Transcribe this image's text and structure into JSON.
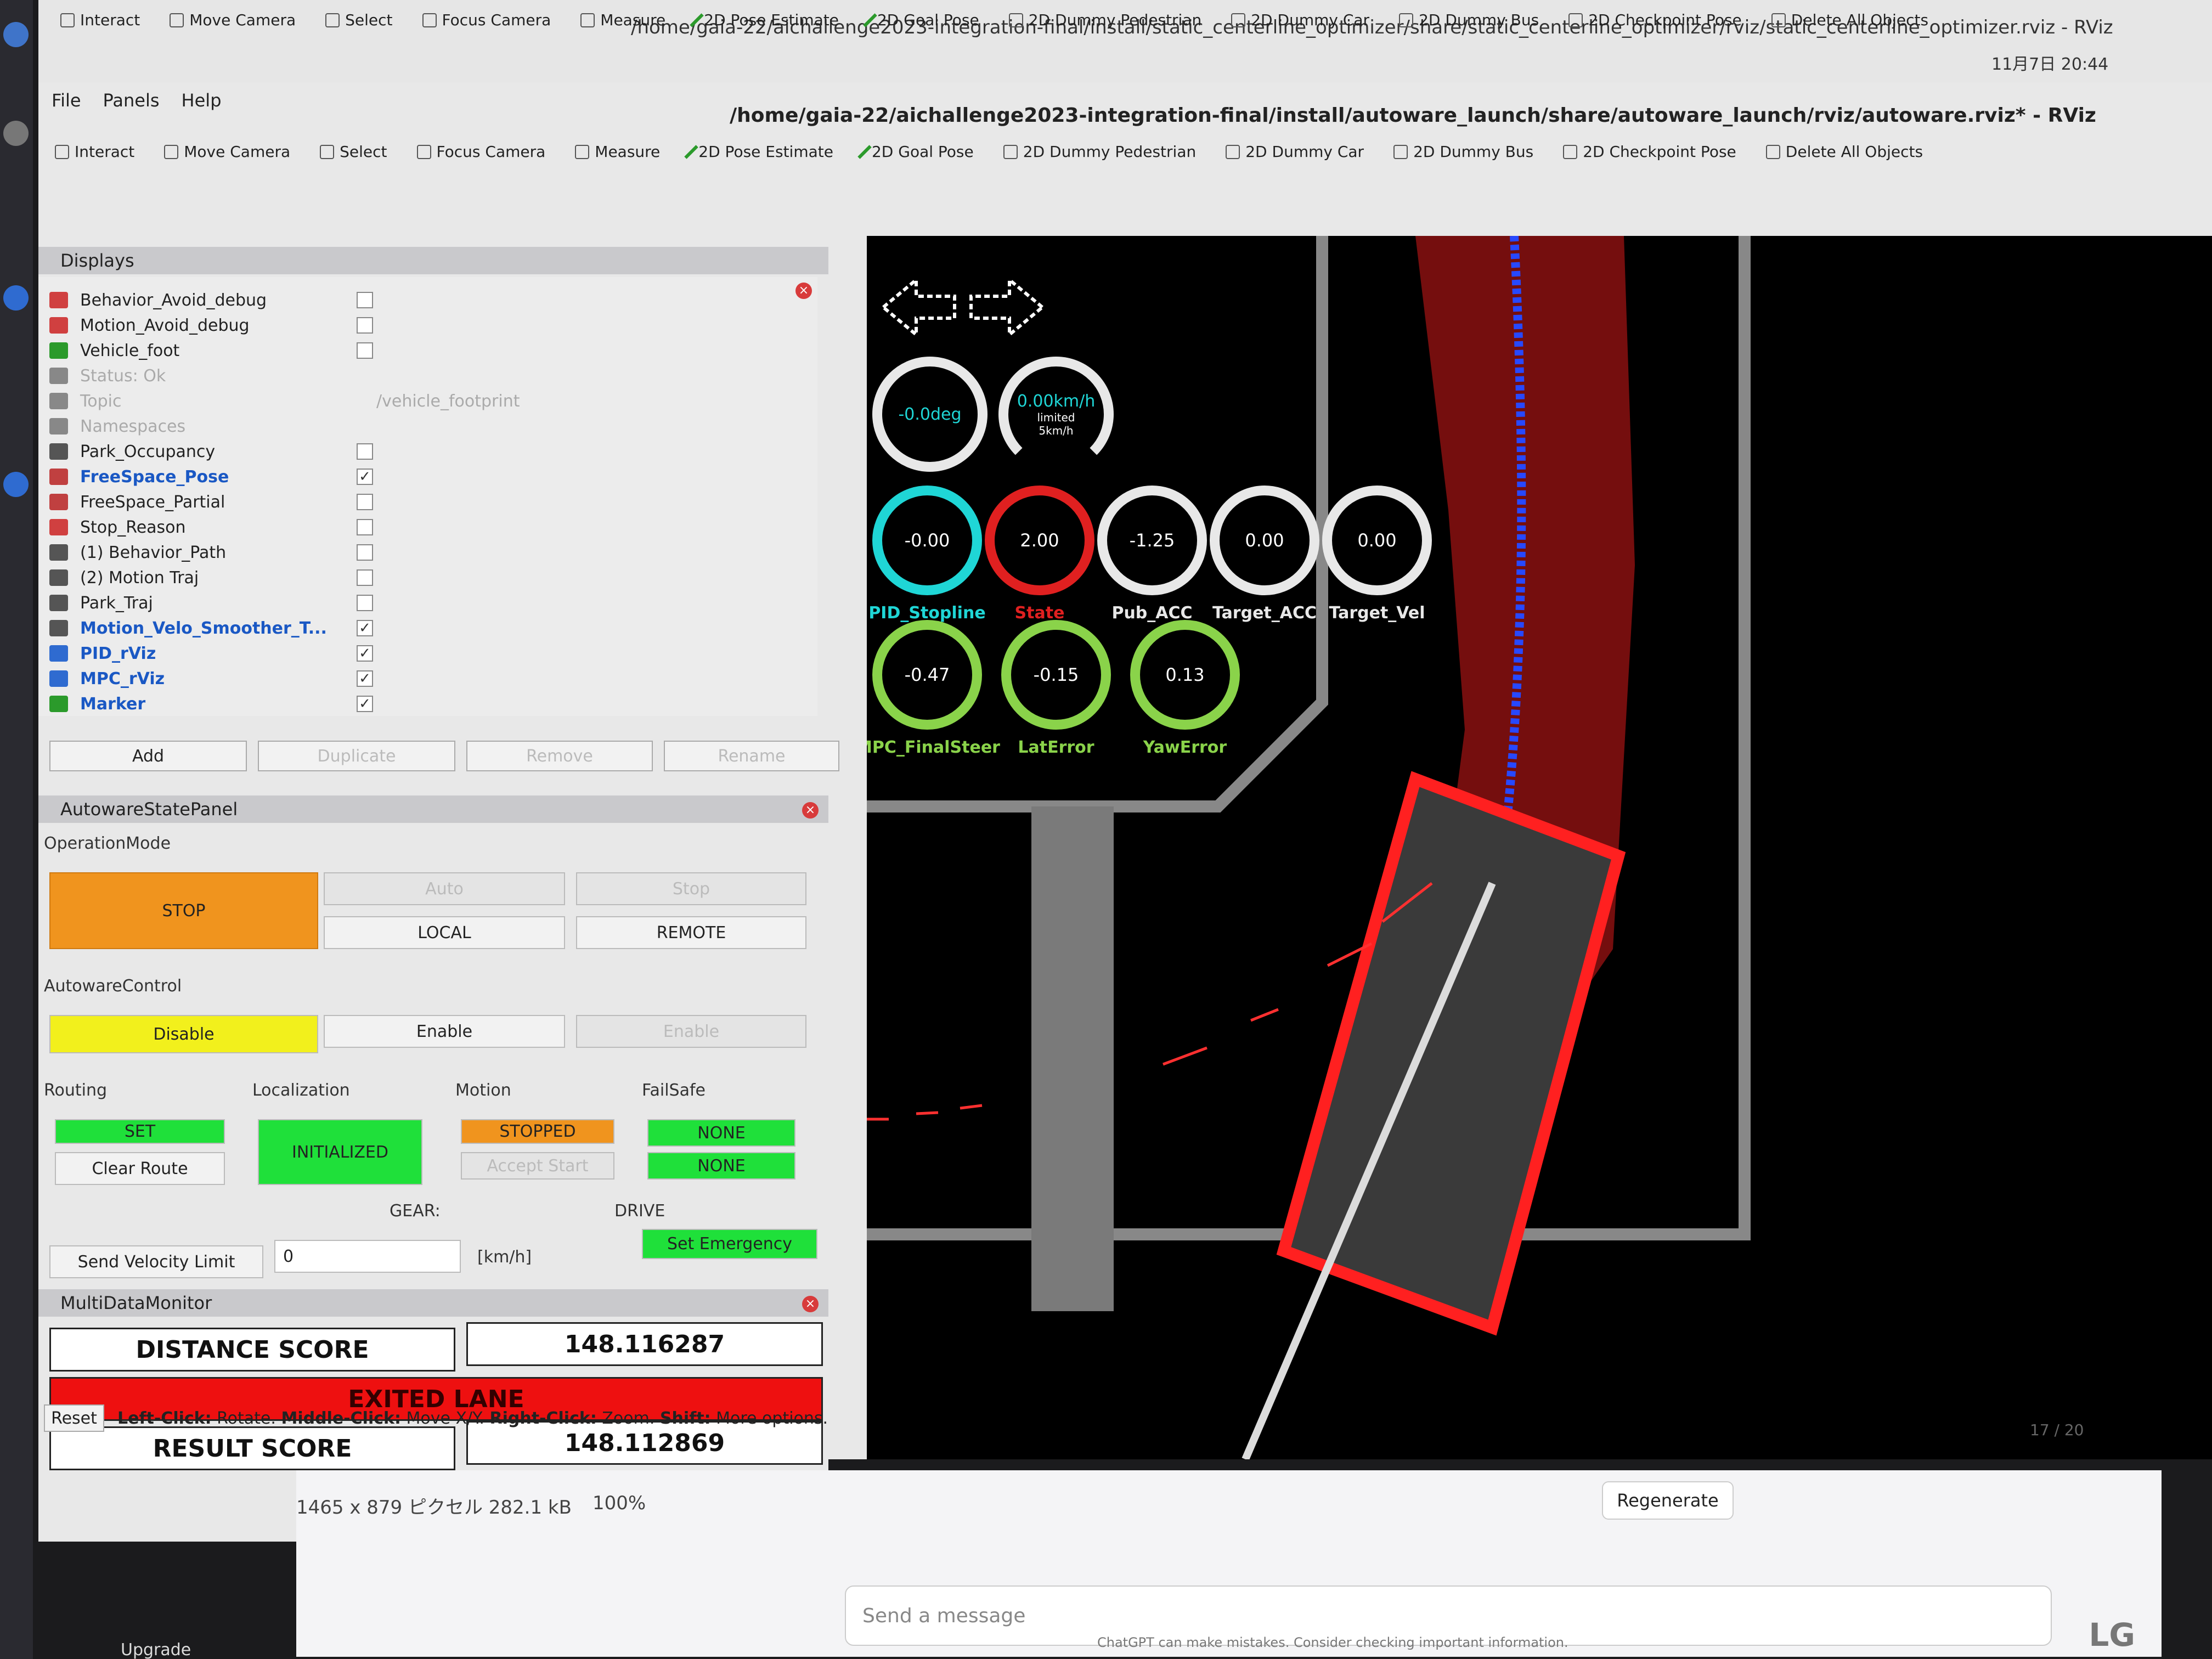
{
  "bg_window": {
    "title": "/home/gaia-22/aichallenge2023-integration-final/install/static_centerline_optimizer/share/static_centerline_optimizer/rviz/static_centerline_optimizer.rviz - RViz",
    "clock": "11月7日 20:44",
    "toolbar": [
      "Interact",
      "Move Camera",
      "Select",
      "Focus Camera",
      "Measure",
      "2D Pose Estimate",
      "2D Goal Pose",
      "2D Dummy Pedestrian",
      "2D Dummy Car",
      "2D Dummy Bus",
      "2D Checkpoint Pose",
      "Delete All Objects"
    ]
  },
  "main_window": {
    "title": "/home/gaia-22/aichallenge2023-integration-final/install/autoware_launch/share/autoware_launch/rviz/autoware.rviz* - RViz",
    "menu": [
      "File",
      "Panels",
      "Help"
    ],
    "toolbar": [
      "Interact",
      "Move Camera",
      "Select",
      "Focus Camera",
      "Measure",
      "2D Pose Estimate",
      "2D Goal Pose",
      "2D Dummy Pedestrian",
      "2D Dummy Car",
      "2D Dummy Bus",
      "2D Checkpoint Pose",
      "Delete All Objects"
    ]
  },
  "displays": {
    "title": "Displays",
    "items": [
      {
        "name": "Behavior_Avoid_debug",
        "checked": false,
        "style": "normal",
        "value": ""
      },
      {
        "name": "Motion_Avoid_debug",
        "checked": false,
        "style": "normal",
        "value": ""
      },
      {
        "name": "Vehicle_foot",
        "checked": false,
        "style": "normal",
        "value": ""
      },
      {
        "name": "Status: Ok",
        "checked": null,
        "style": "grey",
        "value": ""
      },
      {
        "name": "Topic",
        "checked": null,
        "style": "grey",
        "value": "/vehicle_footprint"
      },
      {
        "name": "Namespaces",
        "checked": null,
        "style": "grey",
        "value": ""
      },
      {
        "name": "Park_Occupancy",
        "checked": false,
        "style": "normal",
        "value": ""
      },
      {
        "name": "FreeSpace_Pose",
        "checked": true,
        "style": "blue",
        "value": ""
      },
      {
        "name": "FreeSpace_Partial",
        "checked": false,
        "style": "normal",
        "value": ""
      },
      {
        "name": "Stop_Reason",
        "checked": false,
        "style": "normal",
        "value": ""
      },
      {
        "name": "(1) Behavior_Path",
        "checked": false,
        "style": "normal",
        "value": ""
      },
      {
        "name": "(2) Motion Traj",
        "checked": false,
        "style": "normal",
        "value": ""
      },
      {
        "name": "Park_Traj",
        "checked": false,
        "style": "normal",
        "value": ""
      },
      {
        "name": "Motion_Velo_Smoother_T...",
        "checked": true,
        "style": "blue",
        "value": ""
      },
      {
        "name": "PID_rViz",
        "checked": true,
        "style": "blue",
        "value": ""
      },
      {
        "name": "MPC_rViz",
        "checked": true,
        "style": "blue",
        "value": ""
      },
      {
        "name": "Marker",
        "checked": true,
        "style": "blue",
        "value": ""
      }
    ],
    "buttons": [
      "Add",
      "Duplicate",
      "Remove",
      "Rename"
    ]
  },
  "state_panel": {
    "title": "AutowareStatePanel",
    "operation_mode_label": "OperationMode",
    "stop": "STOP",
    "auto": "Auto",
    "stop_btn": "Stop",
    "local": "LOCAL",
    "remote": "REMOTE",
    "control_label": "AutowareControl",
    "disable": "Disable",
    "enable": "Enable",
    "enable2": "Enable",
    "routing_label": "Routing",
    "routing_state": "SET",
    "clear_route": "Clear Route",
    "localization_label": "Localization",
    "localization_state": "INITIALIZED",
    "motion_label": "Motion",
    "motion_state": "STOPPED",
    "accept_start": "Accept Start",
    "failsafe_label": "FailSafe",
    "failsafe1": "NONE",
    "failsafe2": "NONE",
    "gear_label": "GEAR:",
    "drive_label": "DRIVE",
    "set_emergency": "Set Emergency",
    "send_velocity": "Send Velocity Limit",
    "velocity_value": "0",
    "velocity_unit": "[km/h]"
  },
  "monitor": {
    "title": "MultiDataMonitor",
    "distance_label": "DISTANCE SCORE",
    "distance_value": "148.116287",
    "exited": "EXITED LANE",
    "result_label": "RESULT SCORE",
    "result_value": "148.112869"
  },
  "status_bar": {
    "reset": "Reset",
    "hint_a": "Left-Click:",
    "hint_a_txt": "Rotate.",
    "hint_b": "Middle-Click:",
    "hint_b_txt": "Move X/Y.",
    "hint_c": "Right-Click:",
    "hint_c_txt": "Zoom.",
    "hint_d": "Shift:",
    "hint_d_txt": "More options."
  },
  "view": {
    "steer": "-0.0deg",
    "speed": "0.00km/h",
    "limited": "limited",
    "limit_val": "5km/h",
    "gauges_row1": [
      {
        "value": "-0.00",
        "label": "PID_Stopline",
        "color": "#1fd6d6"
      },
      {
        "value": "2.00",
        "label": "State",
        "color": "#e02020"
      },
      {
        "value": "-1.25",
        "label": "Pub_ACC",
        "color": "#e8e8e8"
      },
      {
        "value": "0.00",
        "label": "Target_ACC",
        "color": "#e8e8e8"
      },
      {
        "value": "0.00",
        "label": "Target_Vel",
        "color": "#e8e8e8"
      }
    ],
    "gauges_row2": [
      {
        "value": "-0.47",
        "label": "MPC_FinalSteer",
        "color": "#8ad34a"
      },
      {
        "value": "-0.15",
        "label": "LatError",
        "color": "#8ad34a"
      },
      {
        "value": "0.13",
        "label": "YawError",
        "color": "#8ad34a"
      }
    ]
  },
  "chat": {
    "image_info": "1465 x 879 ピクセル 282.1 kB",
    "zoom": "100%",
    "regenerate": "Regenerate",
    "page": "17 / 20",
    "placeholder": "Send a message",
    "disclaimer": "ChatGPT can make mistakes. Consider checking important information.",
    "upgrade": "Upgrade"
  },
  "monitor_brand": "LG"
}
